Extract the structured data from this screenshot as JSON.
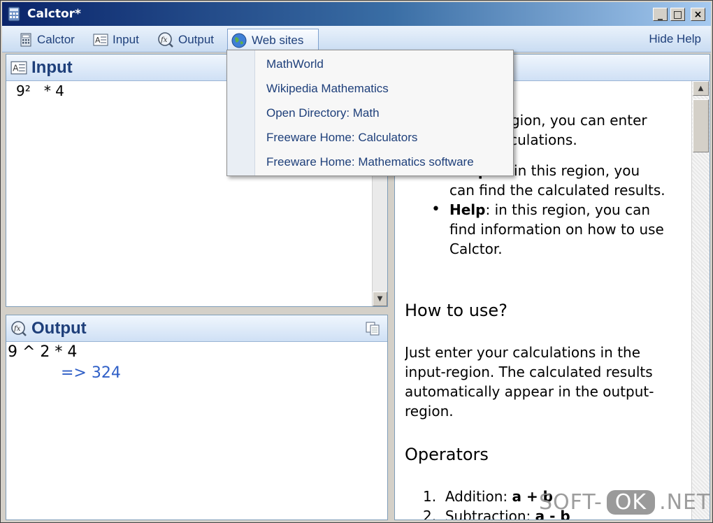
{
  "window": {
    "title": "Calctor*",
    "min": "_",
    "max": "□",
    "close": "×"
  },
  "toolbar": {
    "items": [
      {
        "label": "Calctor",
        "icon": "calculator-icon"
      },
      {
        "label": "Input",
        "icon": "input-icon"
      },
      {
        "label": "Output",
        "icon": "fx-icon"
      },
      {
        "label": "Web sites",
        "icon": "globe-icon"
      }
    ],
    "hide_help": "Hide Help"
  },
  "web_sites_menu": [
    "MathWorld",
    "Wikipedia Mathematics",
    "Open Directory: Math",
    "Freeware Home: Calculators",
    "Freeware Home: Mathematics software"
  ],
  "input": {
    "title": "Input",
    "text": "9²   * 4"
  },
  "output": {
    "title": "Output",
    "expression": "9 ^ 2 * 4",
    "result": "=> 324"
  },
  "help": {
    "intro_partial": "n this region, you can enter your calculations.",
    "bullets": [
      {
        "term": "Output",
        "text": ": in this region, you can find the calculated results."
      },
      {
        "term": "Help",
        "text": ": in this region, you can find information on how to use Calctor."
      }
    ],
    "how_heading": "How to use?",
    "how_text": "Just enter your calculations in the input-region. The calculated results automatically appear in the output-region.",
    "ops_heading": "Operators",
    "ops": [
      {
        "num": "1.",
        "label": "Addition: ",
        "expr": "a + b"
      },
      {
        "num": "2.",
        "label": "Subtraction: ",
        "expr": "a - b"
      }
    ]
  },
  "watermark": {
    "left": "SOFT-",
    "mid": "OK",
    "right": ".NET"
  }
}
